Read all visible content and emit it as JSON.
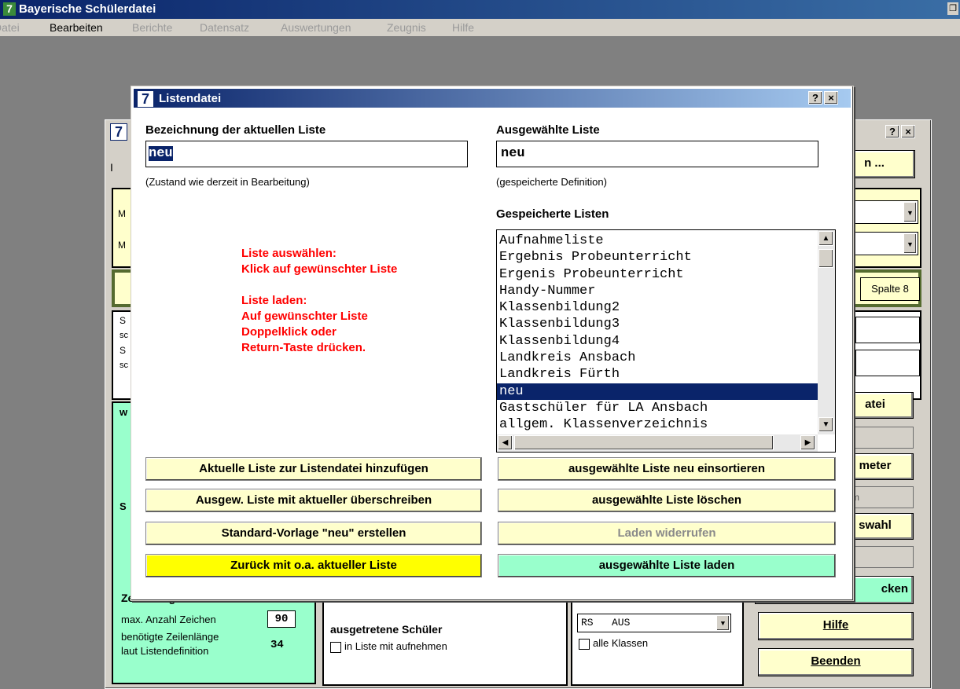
{
  "app": {
    "title": "Bayerische Schülerdatei",
    "icon_glyph": "7"
  },
  "menu": [
    {
      "label": "Datei"
    },
    {
      "label": "Bearbeiten"
    },
    {
      "label": "Berichte"
    },
    {
      "label": "Datensatz"
    },
    {
      "label": "Auswertungen"
    },
    {
      "label": "Zeugnis"
    },
    {
      "label": "Hilfe"
    }
  ],
  "background": {
    "icon_glyph": "7",
    "help_btn": "?",
    "close_btn": "×",
    "top_button": "n ...",
    "spalte_label": "Spalte 8",
    "right_buttons": [
      "atei",
      "meter",
      "swahl",
      "cken"
    ],
    "gray_field_text": "m",
    "hilfe": "Hilfe",
    "beenden": "Beenden",
    "zeilen_heading": "Zeilenlänge",
    "max_zeichen_label": "max. Anzahl Zeichen",
    "max_zeichen_value": "90",
    "benoetigt_label1": "benötigte Zeilenlänge",
    "benoetigt_label2": "laut Listendefinition",
    "benoetigt_value": "34",
    "ausgetreten_heading": "ausgetretene Schüler",
    "ausgetreten_check": "in Liste mit aufnehmen",
    "rs_text": "RS   AUS",
    "alle_klassen": "alle Klassen",
    "left_letters": [
      "M",
      "M",
      "S",
      "sc",
      "S",
      "sc",
      "w",
      "S"
    ]
  },
  "dialog": {
    "title": "Listendatei",
    "help_btn": "?",
    "close_btn": "×",
    "current_label": "Bezeichnung der aktuellen Liste",
    "current_value": "neu",
    "current_note": "(Zustand wie derzeit in Bearbeitung)",
    "selected_label": "Ausgewählte Liste",
    "selected_value": "neu",
    "selected_note": "(gespeicherte Definition)",
    "saved_label": "Gespeicherte Listen",
    "instructions": [
      "Liste auswählen:",
      "Klick auf gewünschter Liste",
      "",
      "Liste laden:",
      "Auf gewünschter Liste",
      "Doppelklick oder",
      "Return-Taste drücken."
    ],
    "saved_lists": [
      "Aufnahmeliste",
      "Ergebnis Probeunterricht",
      "Ergenis Probeunterricht",
      "Handy-Nummer",
      "Klassenbildung2",
      "Klassenbildung3",
      "Klassenbildung4",
      "Landkreis Ansbach",
      "Landkreis Fürth",
      "neu",
      "Gastschüler für LA Ansbach",
      "allgem. Klassenverzeichnis"
    ],
    "selected_index": 9,
    "buttons_left": [
      "Aktuelle Liste zur Listendatei hinzufügen",
      "Ausgew. Liste mit aktueller überschreiben",
      "Standard-Vorlage \"neu\" erstellen",
      "Zurück mit o.a. aktueller Liste"
    ],
    "buttons_right": [
      "ausgewählte Liste neu einsortieren",
      "ausgewählte Liste löschen",
      "Laden widerrufen",
      "ausgewählte Liste laden"
    ]
  },
  "colors": {
    "title_bar": "#0a246a",
    "button_yellow": "#ffffcc",
    "back_button": "#ffff00",
    "load_button": "#99ffcc",
    "selection": "#0a246a",
    "instruction_red": "#ff0000",
    "panel_green": "#99ffcc",
    "panel_yellow": "#ffffcc"
  }
}
